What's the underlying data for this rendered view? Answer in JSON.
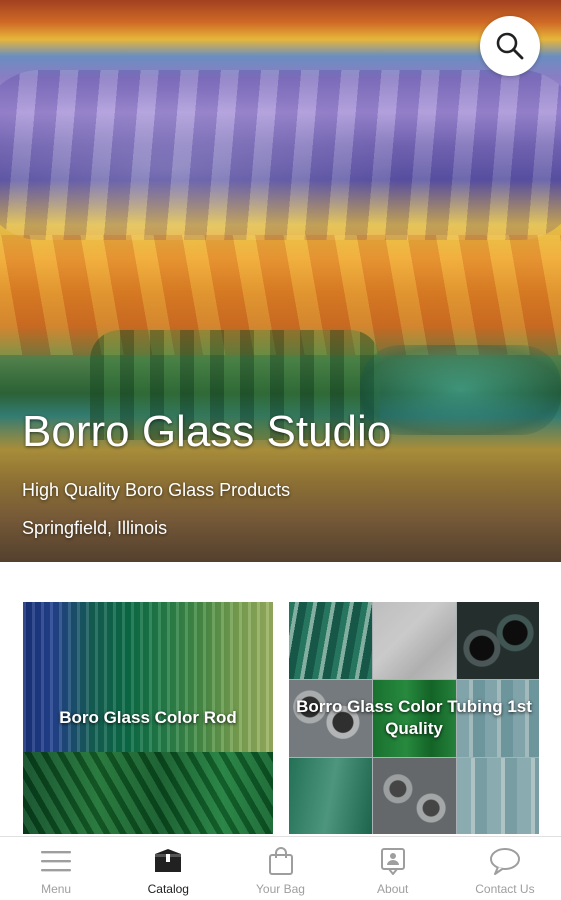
{
  "hero": {
    "title": "Borro Glass Studio",
    "subtitle": "High Quality Boro Glass Products",
    "location": "Springfield, Illinois",
    "search_icon": "search-icon"
  },
  "categories": [
    {
      "label": "Boro Glass Color Rod",
      "accent": "#1f8a4a"
    },
    {
      "label": "Borro Glass Color Tubing 1st Quality",
      "accent": "#8fb9c2"
    }
  ],
  "bottom_nav": {
    "active": "Catalog",
    "items": [
      {
        "label": "Menu",
        "icon": "menu-icon"
      },
      {
        "label": "Catalog",
        "icon": "catalog-icon"
      },
      {
        "label": "Your Bag",
        "icon": "bag-icon"
      },
      {
        "label": "About",
        "icon": "about-icon"
      },
      {
        "label": "Contact Us",
        "icon": "chat-icon"
      }
    ]
  },
  "colors": {
    "nav_active": "#212121",
    "nav_inactive": "#9e9e9e",
    "background": "#ffffff"
  }
}
